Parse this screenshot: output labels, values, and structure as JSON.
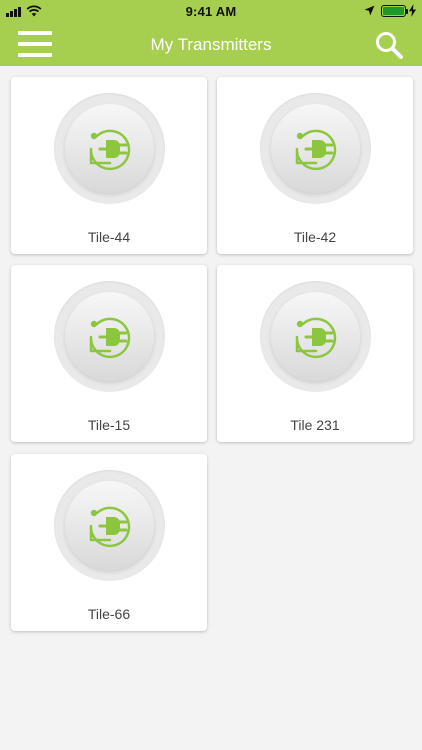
{
  "status_bar": {
    "time": "9:41 AM",
    "battery_color": "#1d9b2a"
  },
  "header": {
    "title": "My Transmitters",
    "background_color": "#a6cf4f",
    "menu_icon": "hamburger-menu-icon",
    "search_icon": "search-icon"
  },
  "tiles": [
    {
      "label": "Tile-44",
      "icon": "plug-icon"
    },
    {
      "label": "Tile-42",
      "icon": "plug-icon"
    },
    {
      "label": "Tile-15",
      "icon": "plug-icon"
    },
    {
      "label": "Tile 231",
      "icon": "plug-icon"
    },
    {
      "label": "Tile-66",
      "icon": "plug-icon"
    }
  ],
  "accent_color": "#8cc63f"
}
